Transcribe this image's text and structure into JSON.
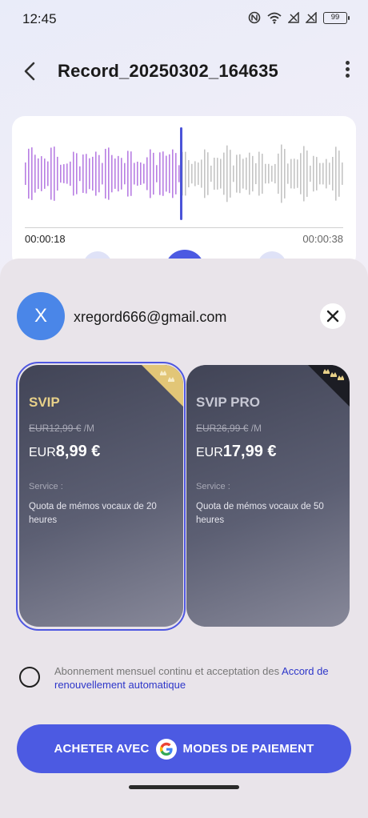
{
  "status_bar": {
    "time": "12:45",
    "battery": "99"
  },
  "header": {
    "title": "Record_20250302_164635"
  },
  "player": {
    "current_time": "00:00:18",
    "total_time": "00:00:38"
  },
  "colors": {
    "played_wave": "#b87ee3",
    "unplayed_wave": "#c4c4c4",
    "accent": "#4c5ae2",
    "avatar": "#4a86e8"
  },
  "account": {
    "avatar_letter": "X",
    "email": "xregord666@gmail.com"
  },
  "plans": [
    {
      "name": "SVIP",
      "old_price": "EUR12,99 €",
      "per": " /M",
      "currency": "EUR",
      "price": "8,99 €",
      "service_label": "Service :",
      "service": "Quota de mémos vocaux de 20 heures",
      "selected": true
    },
    {
      "name": "SVIP PRO",
      "old_price": "EUR26,99 €",
      "per": " /M",
      "currency": "EUR",
      "price": "17,99 €",
      "service_label": "Service :",
      "service": "Quota de mémos vocaux de 50 heures",
      "selected": false
    }
  ],
  "agreement": {
    "text": "Abonnement mensuel continu et acceptation des ",
    "link": "Accord de renouvellement automatique"
  },
  "buy": {
    "label_left": "ACHETER AVEC",
    "label_right": "MODES DE PAIEMENT"
  }
}
